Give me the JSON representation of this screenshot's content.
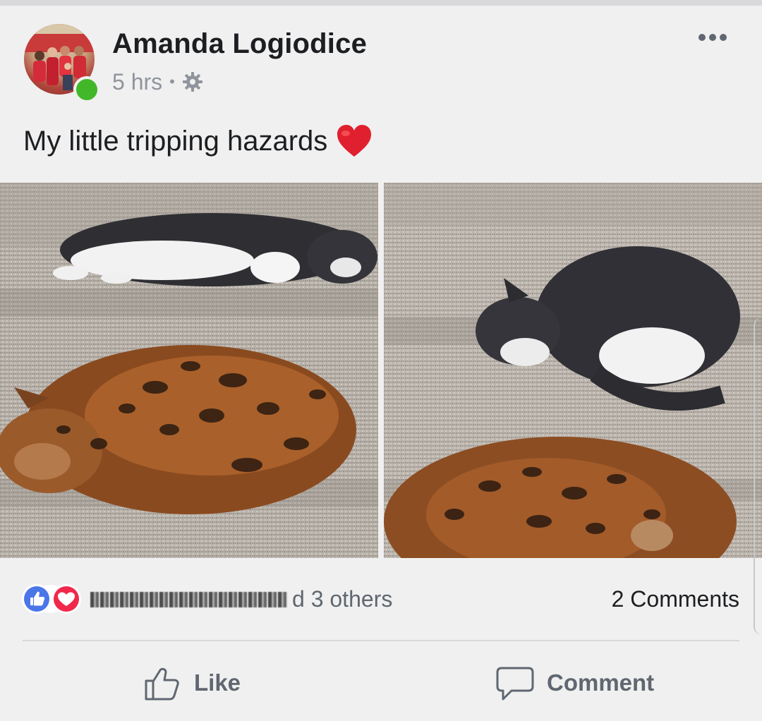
{
  "post": {
    "author_name": "Amanda Logiodice",
    "timestamp": "5 hrs",
    "separator": "•",
    "privacy_icon": "gear-icon",
    "more_icon": "more-options-icon",
    "text": "My little tripping hazards",
    "emoji": "red-heart-emoji",
    "photos": [
      {
        "subject": "cats on stairs"
      },
      {
        "subject": "cats on stairs"
      }
    ]
  },
  "reactions": {
    "icons": [
      "like-reaction-icon",
      "love-reaction-icon"
    ],
    "likers_text": "d 3 others",
    "comments_count": "2 Comments"
  },
  "actions": {
    "like_label": "Like",
    "comment_label": "Comment"
  },
  "colors": {
    "background": "#f0f0f0",
    "online": "#42b72a",
    "like_blue": "#4a76e8",
    "love_red": "#f0284a",
    "secondary_text": "#606770"
  }
}
